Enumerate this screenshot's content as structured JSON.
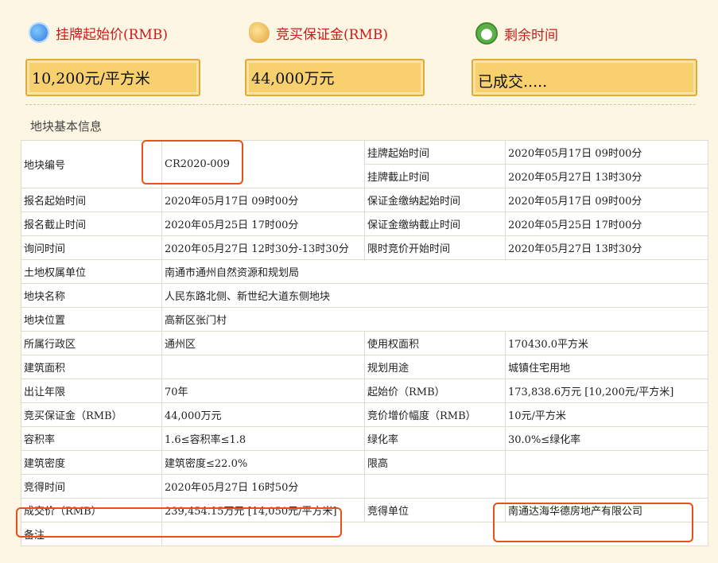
{
  "header": {
    "price_label": "挂牌起始价(RMB)",
    "deposit_label": "竞买保证金(RMB)",
    "remaining_label": "剩余时间",
    "price_value": "10,200元/平方米",
    "deposit_value": "44,000万元",
    "remaining_value": "已成交....."
  },
  "section_title": "地块基本信息",
  "rows": {
    "r0": {
      "k1": "地块编号",
      "v1": "CR2020-009",
      "k2": "挂牌起始时间",
      "v2": "2020年05月17日 09时00分"
    },
    "r1": {
      "k2": "挂牌截止时间",
      "v2": "2020年05月27日 13时30分"
    },
    "r2": {
      "k1": "报名起始时间",
      "v1": "2020年05月17日 09时00分",
      "k2": "保证金缴纳起始时间",
      "v2": "2020年05月17日 09时00分"
    },
    "r3": {
      "k1": "报名截止时间",
      "v1": "2020年05月25日 17时00分",
      "k2": "保证金缴纳截止时间",
      "v2": "2020年05月25日 17时00分"
    },
    "r4": {
      "k1": "询问时间",
      "v1": "2020年05月27日 12时30分-13时30分",
      "k2": "限时竞价开始时间",
      "v2": "2020年05月27日 13时30分"
    },
    "r5": {
      "k1": "土地权属单位",
      "v1": "南通市通州自然资源和规划局"
    },
    "r6": {
      "k1": "地块名称",
      "v1": "人民东路北侧、新世纪大道东侧地块"
    },
    "r7": {
      "k1": "地块位置",
      "v1": "高新区张门村"
    },
    "r8": {
      "k1": "所属行政区",
      "v1": "通州区",
      "k2": "使用权面积",
      "v2": "170430.0平方米"
    },
    "r9": {
      "k1": "建筑面积",
      "v1": "",
      "k2": "规划用途",
      "v2": "城镇住宅用地"
    },
    "r10": {
      "k1": "出让年限",
      "v1": "70年",
      "k2": "起始价（RMB）",
      "v2": "173,838.6万元 [10,200元/平方米]"
    },
    "r11": {
      "k1": "竞买保证金（RMB）",
      "v1": "44,000万元",
      "k2": "竞价增价幅度（RMB）",
      "v2": "10元/平方米"
    },
    "r12": {
      "k1": "容积率",
      "v1": "1.6≤容积率≤1.8",
      "k2": "绿化率",
      "v2": "30.0%≤绿化率"
    },
    "r13": {
      "k1": "建筑密度",
      "v1": "建筑密度≤22.0%",
      "k2": "限高",
      "v2": ""
    },
    "r14": {
      "k1": "竞得时间",
      "v1": "2020年05月27日 16时50分",
      "k2": "",
      "v2": ""
    },
    "r15": {
      "k1": "成交价（RMB）",
      "v1": "239,454.15万元 [14,050元/平方米]",
      "k2": "竞得单位",
      "v2": "南通达海华德房地产有限公司"
    },
    "r16": {
      "k1": "备注",
      "v1": ""
    }
  },
  "colors": {
    "highlight": "#e8501a",
    "label_red": "#cc1a1a",
    "box_fill": "#f8d16e"
  },
  "icons": [
    "rmb-coin-icon",
    "gold-coins-icon",
    "alarm-clock-icon"
  ]
}
